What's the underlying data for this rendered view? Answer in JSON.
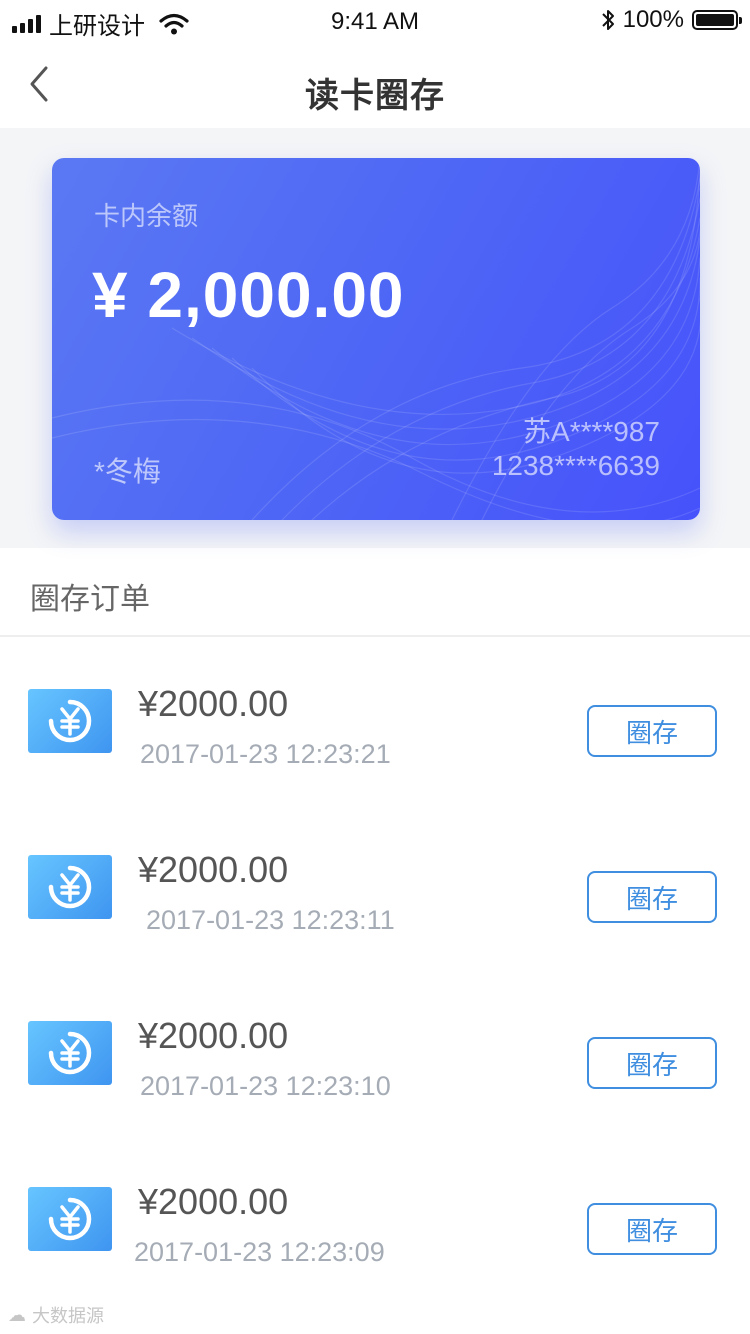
{
  "status_bar": {
    "carrier": "上研设计",
    "time": "9:41 AM",
    "battery": "100%",
    "signal_icon": "signal-bars-icon",
    "wifi_icon": "wifi-icon",
    "bluetooth_icon": "bluetooth-icon",
    "battery_level": 1.0
  },
  "nav": {
    "title": "读卡圈存",
    "back_icon": "chevron-left-icon"
  },
  "card": {
    "balance_label": "卡内余额",
    "balance": "¥ 2,000.00",
    "plate": "苏A****987",
    "holder": "*冬梅",
    "card_number": "1238****6639"
  },
  "orders_section": {
    "title": "圈存订单",
    "items": [
      {
        "amount": "¥2000.00",
        "time": "2017-01-23 12:23:21",
        "action": "圈存",
        "icon": "yuan-coin-icon"
      },
      {
        "amount": "¥2000.00",
        "time": "2017-01-23 12:23:11",
        "action": "圈存",
        "icon": "yuan-coin-icon"
      },
      {
        "amount": "¥2000.00",
        "time": "2017-01-23 12:23:10",
        "action": "圈存",
        "icon": "yuan-coin-icon"
      },
      {
        "amount": "¥2000.00",
        "time": "2017-01-23 12:23:09",
        "action": "圈存",
        "icon": "yuan-coin-icon"
      }
    ]
  },
  "watermark": "大数据源",
  "colors": {
    "card_gradient_start": "#5b79f3",
    "card_gradient_end": "#4652fb",
    "accent_blue": "#3f8ee0",
    "icon_gradient_start": "#67c5ff",
    "icon_gradient_end": "#3f95f0"
  }
}
